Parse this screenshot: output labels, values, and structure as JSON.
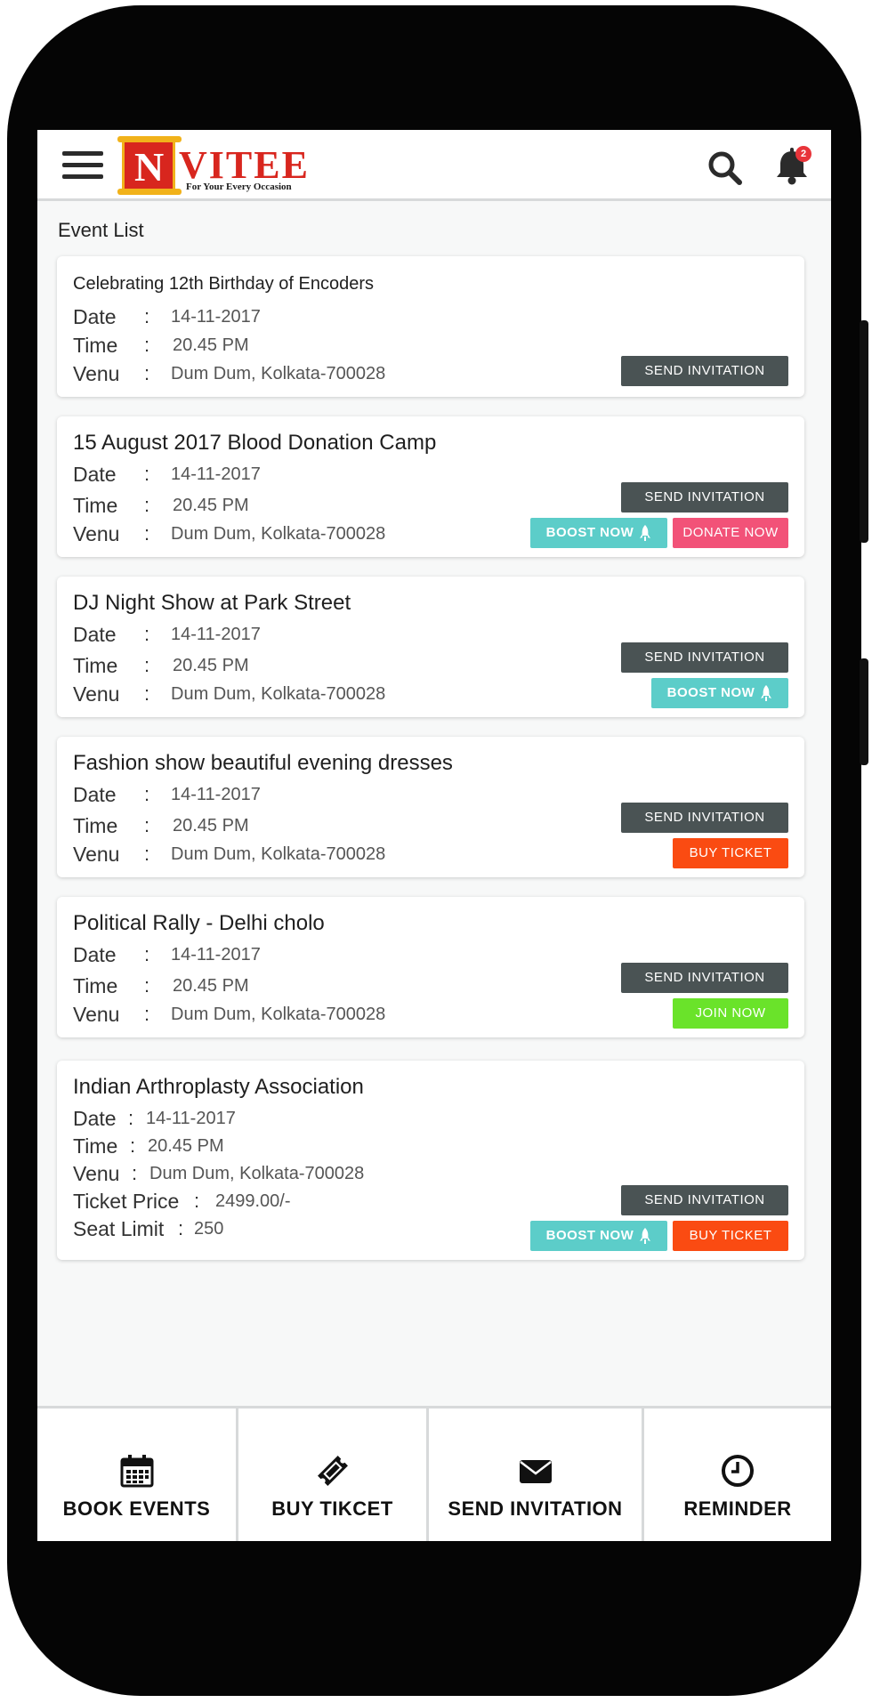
{
  "header": {
    "logo_letter": "N",
    "logo_rest": "VITEE",
    "logo_tagline": "For Your Every Occasion",
    "notification_count": "2"
  },
  "section_title": "Event List",
  "labels": {
    "date": "Date",
    "time": "Time",
    "venue": "Venu",
    "ticket_price": "Ticket Price",
    "seat_limit": "Seat Limit",
    "colon": ":"
  },
  "buttons": {
    "send_invitation": "SEND INVITATION",
    "boost_now": "BOOST NOW",
    "donate_now": "DONATE NOW",
    "buy_ticket": "BUY TICKET",
    "join_now": "JOIN NOW"
  },
  "events": [
    {
      "title": "Celebrating 12th Birthday of Encoders",
      "date": "14-11-2017",
      "time": "20.45 PM",
      "venue": "Dum Dum, Kolkata-700028"
    },
    {
      "title": "15 August 2017 Blood Donation Camp",
      "date": "14-11-2017",
      "time": "20.45 PM",
      "venue": "Dum Dum, Kolkata-700028"
    },
    {
      "title": "DJ Night Show at Park Street",
      "date": "14-11-2017",
      "time": "20.45 PM",
      "venue": "Dum Dum, Kolkata-700028"
    },
    {
      "title": "Fashion show beautiful evening dresses",
      "date": "14-11-2017",
      "time": "20.45 PM",
      "venue": "Dum Dum, Kolkata-700028"
    },
    {
      "title": "Political Rally - Delhi cholo",
      "date": "14-11-2017",
      "time": "20.45 PM",
      "venue": "Dum Dum, Kolkata-700028"
    },
    {
      "title": "Indian Arthroplasty Association",
      "date": "14-11-2017",
      "time": "20.45 PM",
      "venue": "Dum Dum, Kolkata-700028",
      "ticket_price": "2499.00/-",
      "seat_limit": "250"
    }
  ],
  "bottom_nav": [
    {
      "label": "BOOK EVENTS",
      "icon": "calendar-icon"
    },
    {
      "label": "BUY TIKCET",
      "icon": "ticket-icon"
    },
    {
      "label": "SEND INVITATION",
      "icon": "envelope-icon"
    },
    {
      "label": "REMINDER",
      "icon": "clock-icon"
    }
  ],
  "colors": {
    "send": "#4a5354",
    "boost": "#5ccdc9",
    "donate": "#f25278",
    "buy": "#fa4b12",
    "join": "#6ae32a",
    "brand_red": "#d8261e",
    "brand_gold": "#f1b21a"
  }
}
